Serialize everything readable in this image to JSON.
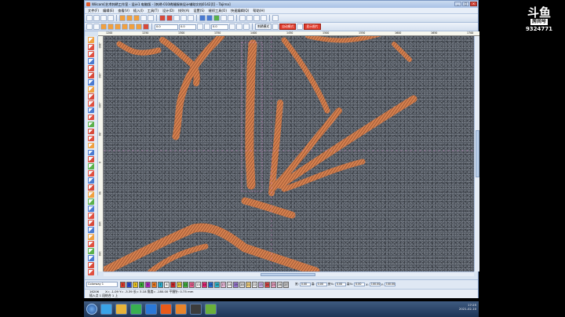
{
  "app": {
    "title": "Wilcom[艺术刺绣工作室 - 设计1 电脑版 - [刺绣-010绣缝服装设计辅助文档0142页] - Tajima]",
    "window_buttons": [
      "_",
      "□",
      "×"
    ]
  },
  "menu": [
    "文件(F)",
    "编辑(E)",
    "查看(V)",
    "插入(I)",
    "工具(T)",
    "设计(D)",
    "排列(A)",
    "设置(S)",
    "缝纫工具(O)",
    "快速编辑(Q)",
    "帮助(H)"
  ],
  "toolbar": {
    "zoom_value": "0.0",
    "size_value": "0.0",
    "density_value": "0.0",
    "mode_label": "刺绣模式",
    "auto_mode_label": "自动模式",
    "show_all_label": "显示图片"
  },
  "ruler_top": [
    "1200",
    "1250",
    "1300",
    "1350",
    "1400",
    "1450",
    "1500",
    "1550",
    "1600",
    "1650",
    "1700"
  ],
  "ruler_left": [
    "-200",
    "-150",
    "-100",
    "-50",
    "0",
    "50",
    "100",
    "150"
  ],
  "colorbar": {
    "colorway": "Colorway 1",
    "swatches": [
      {
        "n": "1",
        "c": "#d83a2a"
      },
      {
        "n": "2",
        "c": "#2a48c8"
      },
      {
        "n": "3",
        "c": "#e8c020"
      },
      {
        "n": "4",
        "c": "#38a838"
      },
      {
        "n": "5",
        "c": "#a82ab8"
      },
      {
        "n": "6",
        "c": "#e87820"
      },
      {
        "n": "7",
        "c": "#28a8c8"
      },
      {
        "n": "8",
        "c": "#f2f2f2"
      },
      {
        "n": "9",
        "c": "#c82828"
      },
      {
        "n": "10",
        "c": "#e8d040"
      },
      {
        "n": "11",
        "c": "#40b040"
      },
      {
        "n": "12",
        "c": "#e86090"
      },
      {
        "n": "13",
        "c": "#f0f0f0"
      },
      {
        "n": "14",
        "c": "#e82878"
      },
      {
        "n": "15",
        "c": "#2870d8"
      },
      {
        "n": "16",
        "c": "#30b8d0"
      },
      {
        "n": "17",
        "c": "#e8b8d8"
      },
      {
        "n": "18",
        "c": "#f4f4f4"
      },
      {
        "n": "19",
        "c": "#9878d0"
      },
      {
        "n": "20",
        "c": "#d8d8d8"
      },
      {
        "n": "21",
        "c": "#f0d080"
      },
      {
        "n": "22",
        "c": "#e8e8e8"
      },
      {
        "n": "23",
        "c": "#c8b0e8"
      },
      {
        "n": "24",
        "c": "#d84848"
      },
      {
        "n": "25",
        "c": "#e8a0c0"
      },
      {
        "n": "26",
        "c": "#e0e0e0"
      },
      {
        "n": "27",
        "c": "#c8c8c8"
      }
    ],
    "params": [
      {
        "label": "宽:",
        "value": "0.00"
      },
      {
        "label": "高:",
        "value": "0.00"
      },
      {
        "label": "宽%:",
        "value": "0.00"
      },
      {
        "label": "高%:",
        "value": "0.00"
      },
      {
        "label": "X:",
        "value": "100.00"
      },
      {
        "label": "Y:",
        "value": "100.00"
      }
    ]
  },
  "status": {
    "stitch_count": "16206",
    "coords": "X= -1.09 Y= -3.39 长= 3.18 角度= -180.00 平缝针: 0.75 mm",
    "hint": "插入点 1 段结合 1 上"
  },
  "taskbar": {
    "time": "17:25",
    "date": "2021-02-10"
  },
  "watermark": {
    "logo": "斗鱼",
    "sub": "房间号",
    "room_id": "9324771"
  },
  "colors": {
    "thread": "#d4804f",
    "thread_shadow": "#7a3e22",
    "fabric": "#545a63",
    "selection": "#d98cd0",
    "accent_red": "#e23a2a"
  }
}
